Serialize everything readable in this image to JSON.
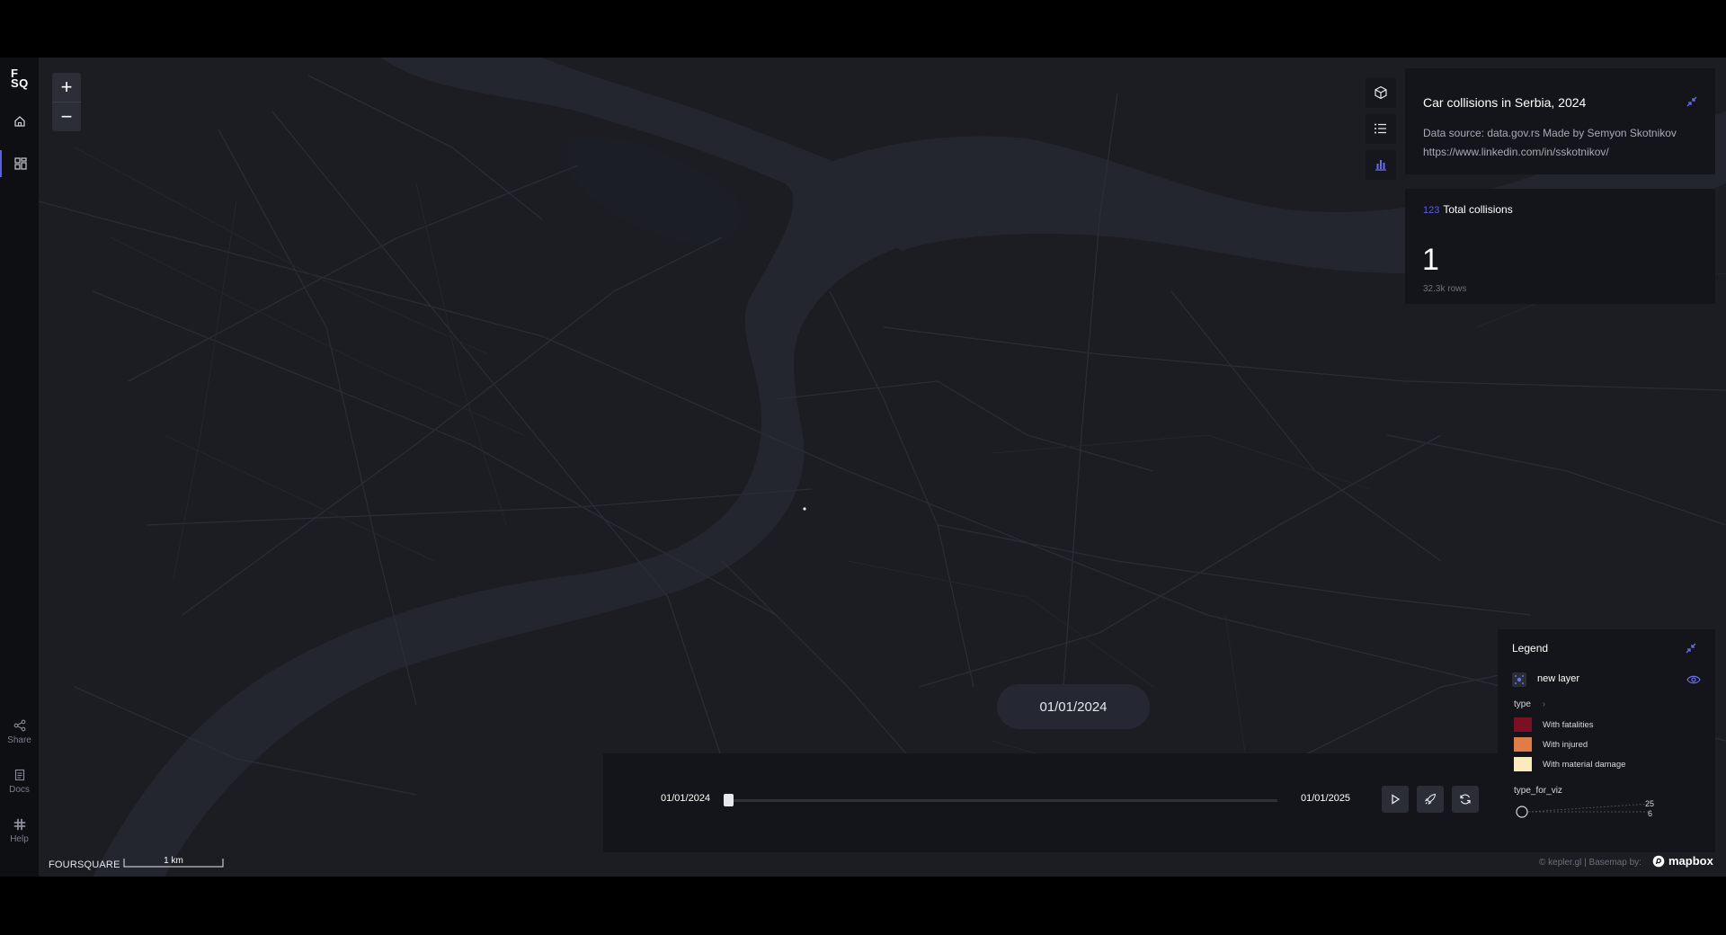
{
  "nav": {
    "logo_line1": "F",
    "logo_line2": "SQ",
    "share_label": "Share",
    "docs_label": "Docs",
    "help_label": "Help"
  },
  "map": {
    "brand": "FOURSQUARE",
    "scale_label": "1 km",
    "attribution": "© kepler.gl | Basemap by:",
    "basemap_provider": "mapbox",
    "current_date": "01/01/2024"
  },
  "title_panel": {
    "title": "Car collisions in Serbia, 2024",
    "description": "Data source: data.gov.rs Made by Semyon Skotnikov https://www.linkedin.com/in/sskotnikov/"
  },
  "stat_panel": {
    "type_glyph": "123",
    "label": "Total collisions",
    "value": "1",
    "rows": "32.3k rows"
  },
  "legend": {
    "title": "Legend",
    "layer_name": "new layer",
    "color_field": "type",
    "items": [
      {
        "label": "With fatalities",
        "color": "#7b0f24"
      },
      {
        "label": "With injured",
        "color": "#e07c46"
      },
      {
        "label": "With material damage",
        "color": "#fbeabb"
      }
    ],
    "size_field": "type_for_viz",
    "size_max": "25",
    "size_min": "6"
  },
  "timeline": {
    "start": "01/01/2024",
    "end": "01/01/2025",
    "progress": 0
  },
  "colors": {
    "accent": "#5b5fdf",
    "map_bg": "#1a1c22",
    "panel_bg": "#14151b"
  }
}
